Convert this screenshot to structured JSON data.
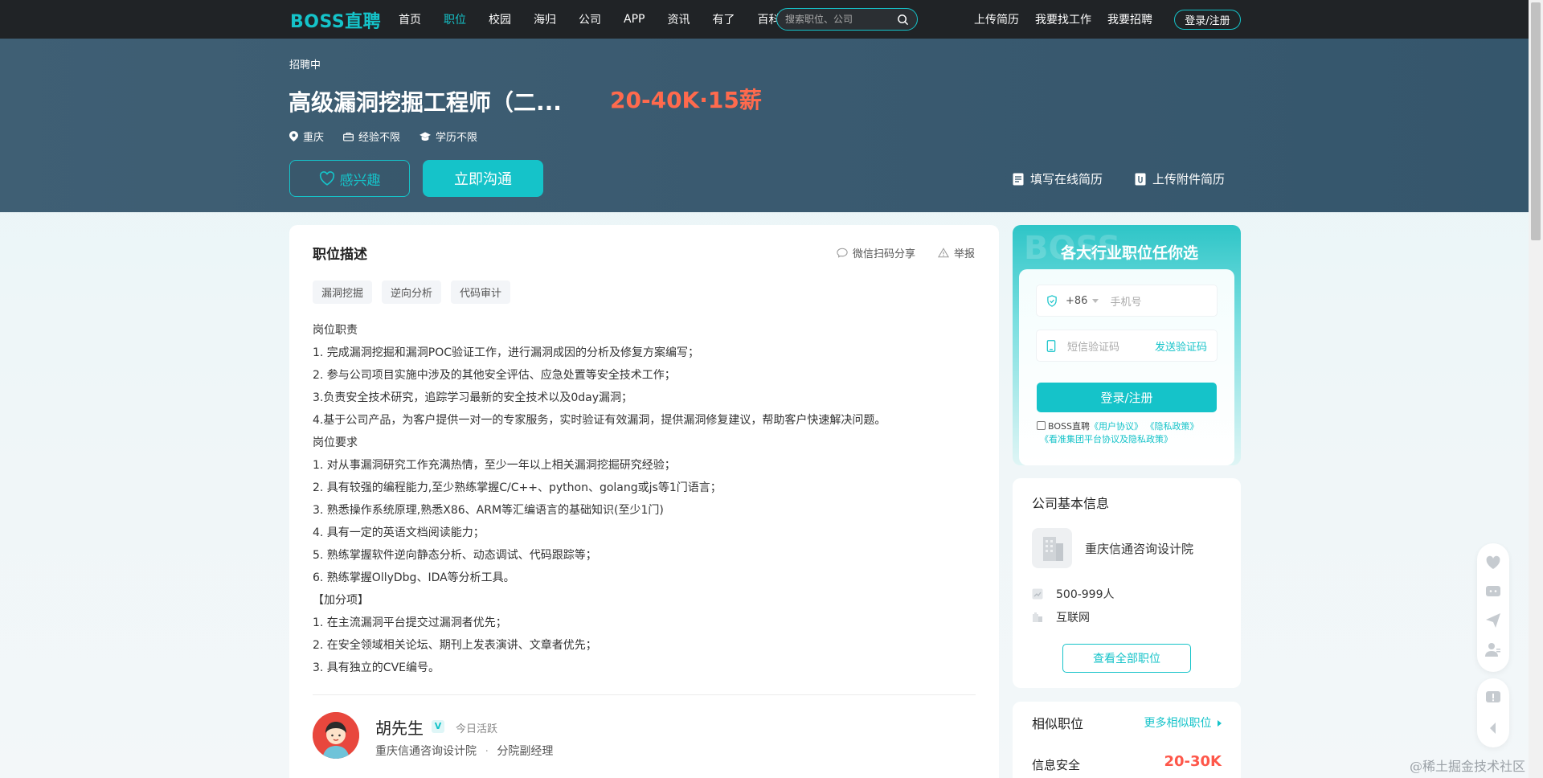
{
  "nav": {
    "logo": "BOSS直聘",
    "links": [
      "首页",
      "职位",
      "校园",
      "海归",
      "公司",
      "APP",
      "资讯",
      "有了",
      "百科"
    ],
    "active_index": 1,
    "search_placeholder": "搜索职位、公司",
    "right_links": [
      "上传简历",
      "我要找工作",
      "我要招聘"
    ],
    "login_label": "登录/注册"
  },
  "job": {
    "status": "招聘中",
    "title": "高级漏洞挖掘工程师（二...",
    "salary": "20-40K·15薪",
    "city": "重庆",
    "experience": "经验不限",
    "education": "学历不限",
    "interest_label": "感兴趣",
    "chat_label": "立即沟通",
    "online_resume_label": "填写在线简历",
    "upload_resume_label": "上传附件简历"
  },
  "description": {
    "title": "职位描述",
    "share_label": "微信扫码分享",
    "report_label": "举报",
    "skill_tags": [
      "漏洞挖掘",
      "逆向分析",
      "代码审计"
    ],
    "lines": [
      "岗位职责",
      "1. 完成漏洞挖掘和漏洞POC验证工作，进行漏洞成因的分析及修复方案编写；",
      "2. 参与公司项目实施中涉及的其他安全评估、应急处置等安全技术工作；",
      "3.负责安全技术研究，追踪学习最新的安全技术以及0day漏洞；",
      "4.基于公司产品，为客户提供一对一的专家服务，实时验证有效漏洞，提供漏洞修复建议，帮助客户快速解决问题。",
      "岗位要求",
      "1. 对从事漏洞研究工作充满热情，至少一年以上相关漏洞挖掘研究经验；",
      "2. 具有较强的编程能力,至少熟练掌握C/C++、python、golang或js等1门语言；",
      "3. 熟悉操作系统原理,熟悉X86、ARM等汇编语言的基础知识(至少1门)",
      "4. 具有一定的英语文档阅读能力；",
      "5. 熟练掌握软件逆向静态分析、动态调试、代码跟踪等；",
      "6. 熟练掌握OllyDbg、IDA等分析工具。",
      "【加分项】",
      "1. 在主流漏洞平台提交过漏洞者优先；",
      "2. 在安全领域相关论坛、期刊上发表演讲、文章者优先；",
      "3. 具有独立的CVE编号。"
    ]
  },
  "recruiter": {
    "name": "胡先生",
    "verified_badge": "V",
    "active_status": "今日活跃",
    "company": "重庆信通咨询设计院",
    "separator": "·",
    "position": "分院副经理"
  },
  "login_panel": {
    "title": "各大行业职位任你选",
    "country_code": "+86",
    "phone_placeholder": "手机号",
    "code_placeholder": "短信验证码",
    "send_code_label": "发送验证码",
    "submit_label": "登录/注册",
    "agree_prefix": "BOSS直聘",
    "user_agreement": "《用户协议》",
    "privacy_policy": "《隐私政策》",
    "group_policy": "《看准集团平台协议及隐私政策》"
  },
  "company": {
    "section_title": "公司基本信息",
    "name": "重庆信通咨询设计院",
    "size": "500-999人",
    "industry": "互联网",
    "all_jobs_label": "查看全部职位"
  },
  "similar": {
    "title": "相似职位",
    "more_label": "更多相似职位",
    "first_job": "信息安全",
    "first_salary": "20-30K"
  },
  "watermark": "@稀土掘金技术社区",
  "colors": {
    "brand": "#15c3c9",
    "salary": "#ff6a4d",
    "nav_bg": "#202326",
    "banner_bg": "#3d5d72"
  }
}
